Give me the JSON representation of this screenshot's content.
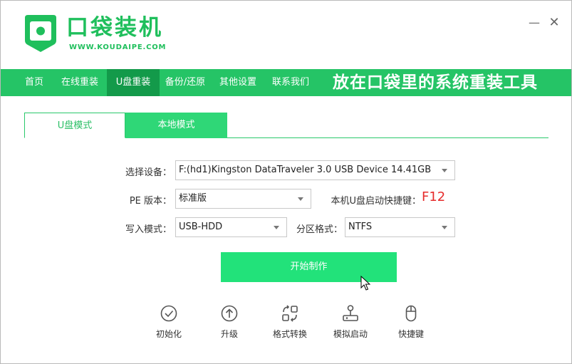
{
  "app": {
    "name": "口袋装机",
    "url": "WWW.KOUDAIPE.COM"
  },
  "window_controls": {
    "minimize": "—",
    "close": "✕"
  },
  "nav": {
    "items": [
      {
        "label": "首页"
      },
      {
        "label": "在线重装"
      },
      {
        "label": "U盘重装",
        "active": true
      },
      {
        "label": "备份/还原"
      },
      {
        "label": "其他设置"
      },
      {
        "label": "联系我们"
      }
    ],
    "slogan": "放在口袋里的系统重装工具"
  },
  "tabs": [
    {
      "label": "U盘模式",
      "active": true
    },
    {
      "label": "本地模式"
    }
  ],
  "form": {
    "device_label": "选择设备：",
    "device_value": "F:(hd1)Kingston DataTraveler 3.0 USB Device 14.41GB",
    "pe_label": "PE 版本：",
    "pe_value": "标准版",
    "hotkey_label": "本机U盘启动快捷键：",
    "hotkey_value": "F12",
    "write_mode_label": "写入模式：",
    "write_mode_value": "USB-HDD",
    "partition_label": "分区格式：",
    "partition_value": "NTFS"
  },
  "start_button": "开始制作",
  "tools": [
    {
      "label": "初始化",
      "icon": "check-circle-icon"
    },
    {
      "label": "升级",
      "icon": "arrow-up-circle-icon"
    },
    {
      "label": "格式转换",
      "icon": "convert-icon"
    },
    {
      "label": "模拟启动",
      "icon": "joystick-icon"
    },
    {
      "label": "快捷键",
      "icon": "mouse-icon"
    }
  ],
  "colors": {
    "brand_green": "#1fbf5c",
    "nav_green": "#25c466",
    "nav_active": "#139a4a",
    "button_green": "#22e27a",
    "hotkey_red": "#e62b2b"
  }
}
